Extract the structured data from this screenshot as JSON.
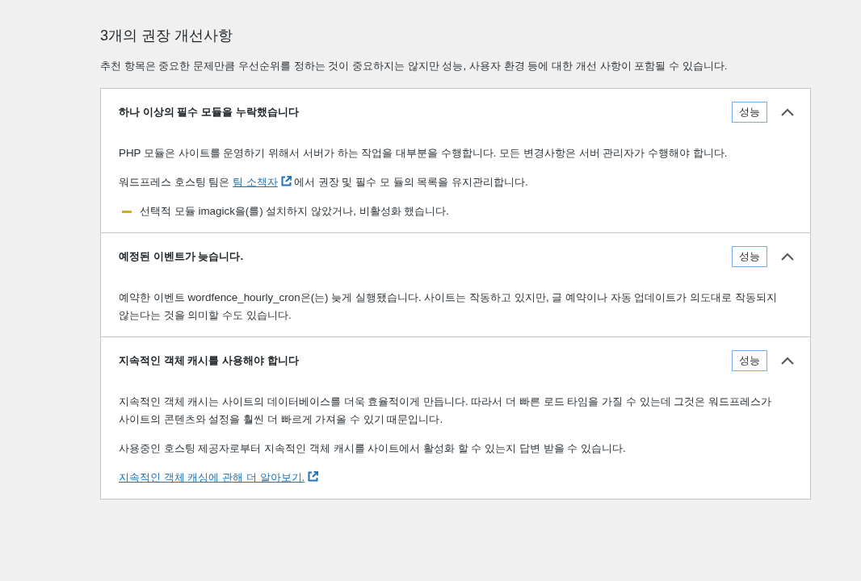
{
  "heading": "3개의 권장 개선사항",
  "description": "추천 항목은 중요한 문제만큼 우선순위를 정하는 것이 중요하지는 않지만 성능, 사용자 환경 등에 대한 개선 사항이 포함될 수 있습니다.",
  "items": [
    {
      "title": "하나 이상의 필수 모듈을 누락했습니다",
      "badge": "성능",
      "expanded": true,
      "content": [
        {
          "kind": "text",
          "text": "PHP 모듈은 사이트를 운영하기 위해서 서버가 하는 작업을 대부분을 수행합니다. 모든 변경사항은 서버 관리자가 수행해야 합니다."
        },
        {
          "kind": "link_text",
          "before": "워드프레스 호스팅 팀은 ",
          "link": "팀 소책자",
          "after": "에서 권장 및 필수 모 듈의 목록을 유지관리합니다."
        },
        {
          "kind": "warning",
          "text": "선택적 모듈 imagick을(를) 설치하지 않았거나, 비활성화 했습니다."
        }
      ]
    },
    {
      "title": "예정된 이벤트가 늦습니다.",
      "badge": "성능",
      "expanded": true,
      "content": [
        {
          "kind": "text",
          "text": "예약한 이벤트 wordfence_hourly_cron은(는) 늦게 실행됐습니다. 사이트는 작동하고 있지만, 글 예약이나 자동 업데이트가 의도대로 작동되지 않는다는 것을 의미할 수도 있습니다."
        }
      ]
    },
    {
      "title": "지속적인 객체 캐시를 사용해야 합니다",
      "badge": "성능",
      "expanded": true,
      "content": [
        {
          "kind": "text",
          "text": "지속적인 객체 캐시는 사이트의 데이터베이스를 더욱 효율적이게 만듭니다. 따라서 더 빠른 로드 타임을 가질 수 있는데 그것은 워드프레스가 사이트의 콘텐츠와 설정을 훨씬 더 빠르게 가져올 수 있기 때문입니다."
        },
        {
          "kind": "text",
          "text": "사용중인 호스팅 제공자로부터 지속적인 객체 캐시를 사이트에서 활성화 할 수 있는지 답변 받을 수 있습니다."
        },
        {
          "kind": "link",
          "link": "지속적인 객체 캐싱에 관해 더 알아보기."
        }
      ]
    }
  ]
}
